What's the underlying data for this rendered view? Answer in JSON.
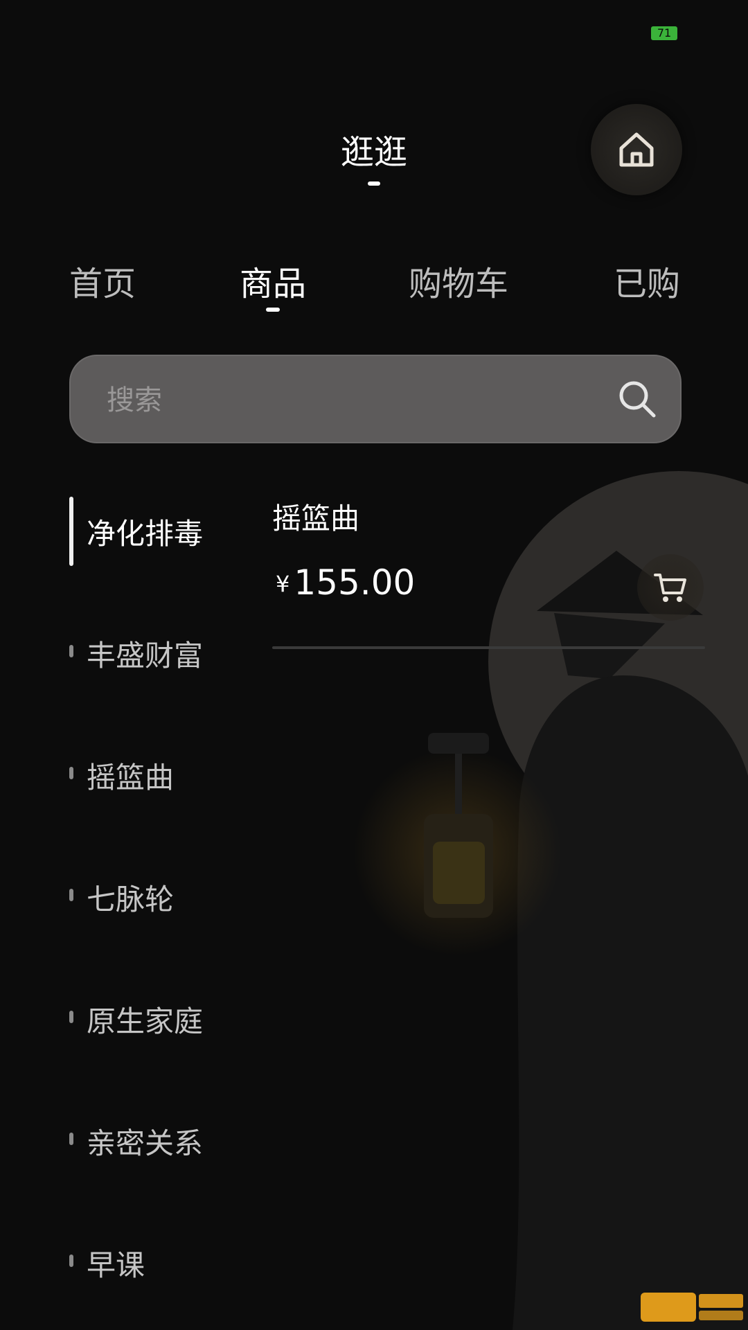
{
  "status_bar": {
    "battery_level": "71"
  },
  "header": {
    "title": "逛逛",
    "home_icon": "home-icon"
  },
  "tabs": [
    {
      "label": "首页",
      "active": false
    },
    {
      "label": "商品",
      "active": true
    },
    {
      "label": "购物车",
      "active": false
    },
    {
      "label": "已购",
      "active": false
    }
  ],
  "search": {
    "placeholder": "搜索",
    "icon": "search-icon"
  },
  "categories": [
    {
      "label": "净化排毒",
      "active": true
    },
    {
      "label": "丰盛财富",
      "active": false
    },
    {
      "label": "摇篮曲",
      "active": false
    },
    {
      "label": "七脉轮",
      "active": false
    },
    {
      "label": "原生家庭",
      "active": false
    },
    {
      "label": "亲密关系",
      "active": false
    },
    {
      "label": "早课",
      "active": false
    }
  ],
  "products": [
    {
      "name": "摇篮曲",
      "currency": "¥",
      "price": "155.00",
      "cart_icon": "cart-icon"
    }
  ],
  "colors": {
    "background": "#0c0c0c",
    "search_bg": "#5d5b5b",
    "battery": "#3bb33a",
    "watermark": "#f4a81c"
  }
}
